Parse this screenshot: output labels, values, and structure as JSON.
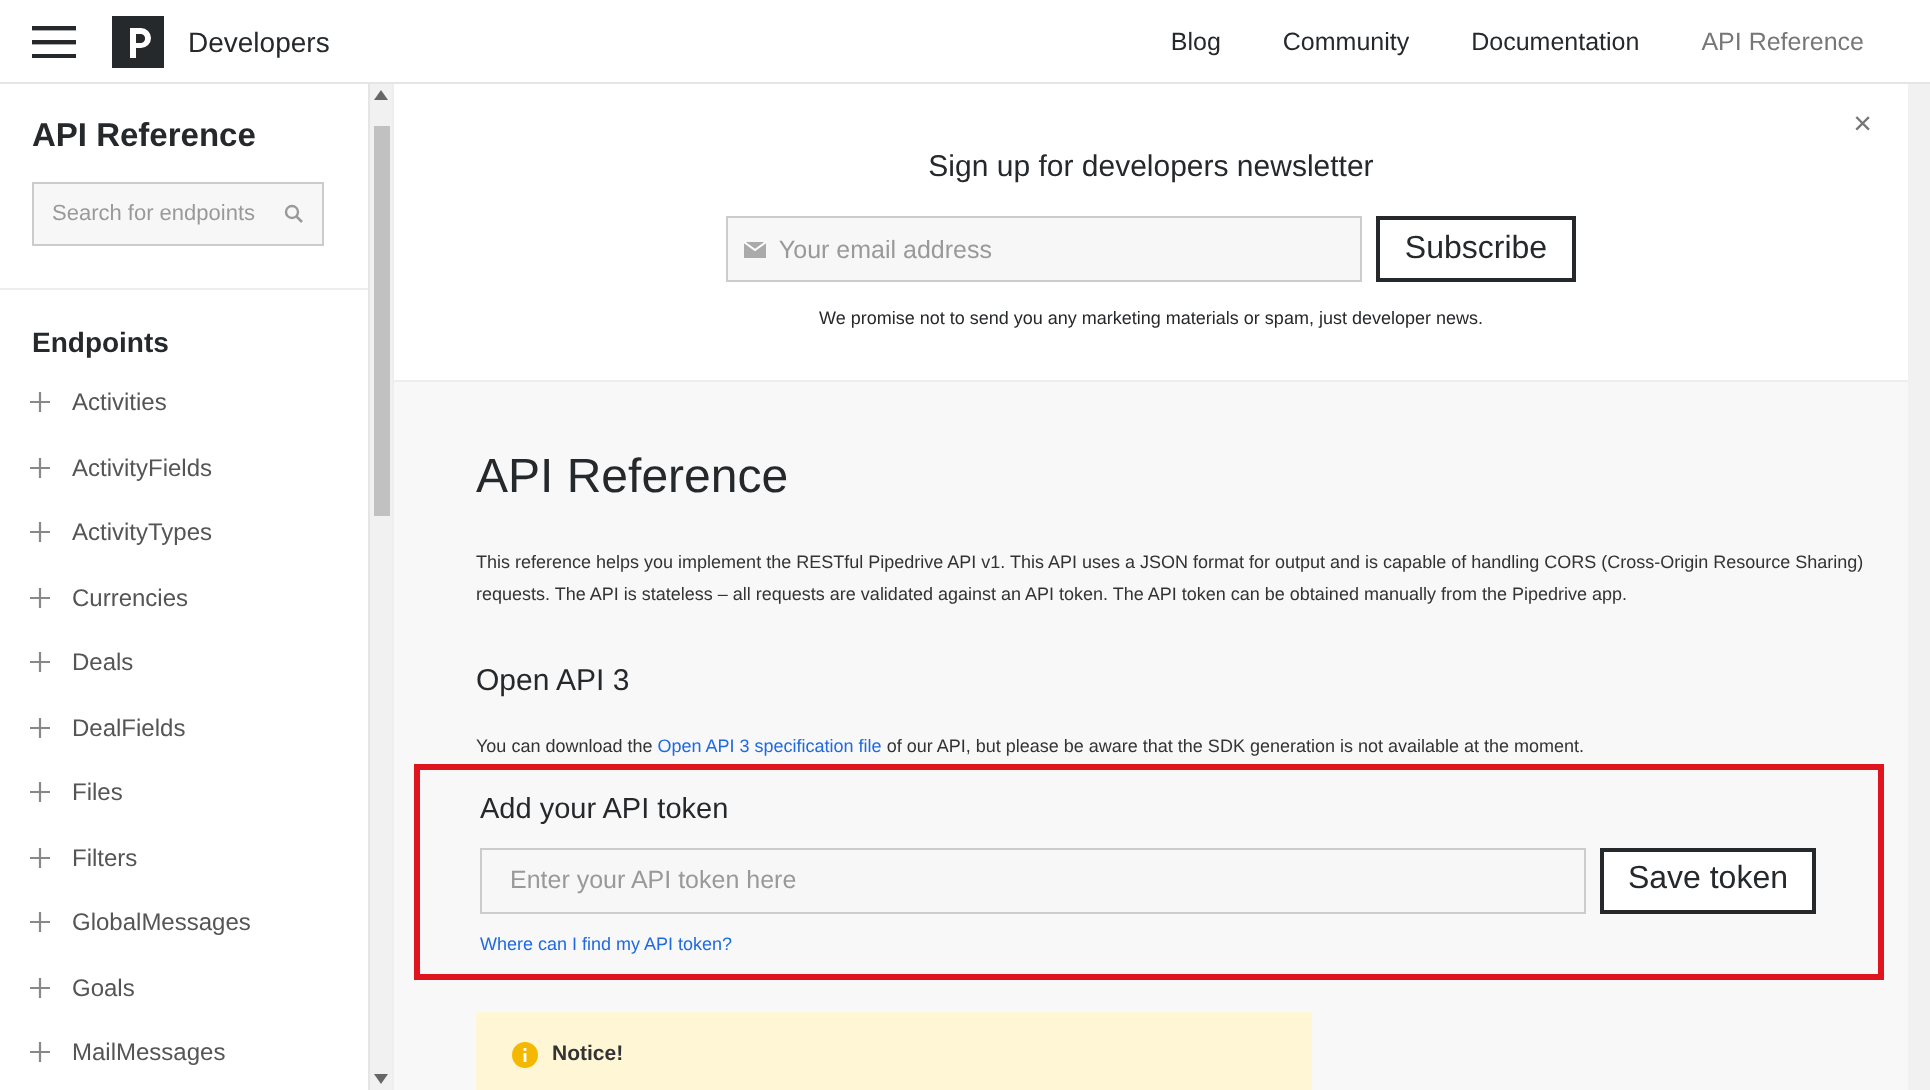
{
  "header": {
    "brand": "Developers",
    "nav": [
      {
        "label": "Blog",
        "selected": false
      },
      {
        "label": "Community",
        "selected": false
      },
      {
        "label": "Documentation",
        "selected": false
      },
      {
        "label": "API Reference",
        "selected": true
      }
    ]
  },
  "sidebar": {
    "title": "API Reference",
    "search": {
      "placeholder": "Search for endpoints"
    },
    "section": "Endpoints",
    "items": [
      {
        "label": "Activities",
        "expanded": false
      },
      {
        "label": "ActivityFields",
        "expanded": false
      },
      {
        "label": "ActivityTypes",
        "expanded": false
      },
      {
        "label": "Currencies",
        "expanded": false
      },
      {
        "label": "Deals",
        "expanded": false
      },
      {
        "label": "DealFields",
        "expanded": false
      },
      {
        "label": "Files",
        "expanded": false
      },
      {
        "label": "Filters",
        "expanded": false
      },
      {
        "label": "GlobalMessages",
        "expanded": false
      },
      {
        "label": "Goals",
        "expanded": false
      },
      {
        "label": "MailMessages",
        "expanded": false
      }
    ]
  },
  "newsletter": {
    "title": "Sign up for developers newsletter",
    "email": {
      "placeholder": "Your email address"
    },
    "button": "Subscribe",
    "note": "We promise not to send you any marketing materials or spam, just developer news.",
    "close": "×"
  },
  "content": {
    "title": "API Reference",
    "intro": "This reference helps you implement the RESTful Pipedrive API v1. This API uses a JSON format for output and is capable of handling CORS (Cross-Origin Resource Sharing) requests. The API is stateless – all requests are validated against an API token. The API token can be obtained manually from the Pipedrive app.",
    "openapi_title": "Open API 3",
    "openapi_before": "You can download the ",
    "openapi_link": "Open API 3 specification file",
    "openapi_after": " of our API, but please be aware that the SDK generation is not available at the moment.",
    "token": {
      "highlighted": true,
      "title": "Add your API token",
      "field": {
        "placeholder": "Enter your API token here"
      },
      "button": "Save token",
      "help_link": "Where can I find my API token?"
    },
    "notice": {
      "title": "Notice!"
    }
  }
}
